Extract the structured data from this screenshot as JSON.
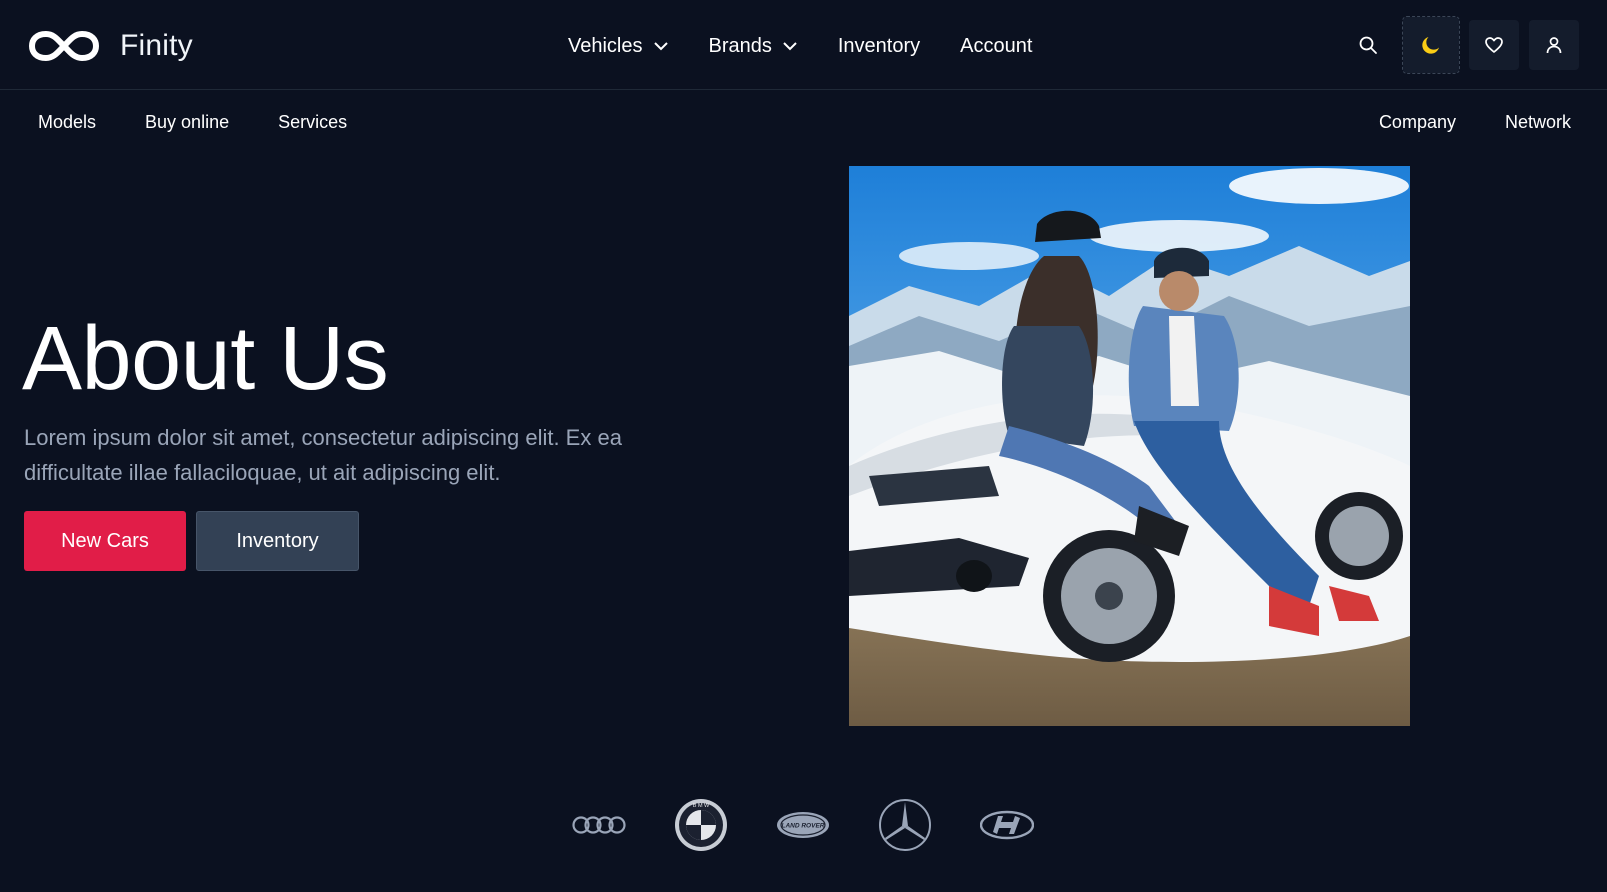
{
  "header": {
    "brand_name": "Finity",
    "logo_icon": "infinity-logo-icon",
    "nav": [
      {
        "label": "Vehicles",
        "has_dropdown": true
      },
      {
        "label": "Brands",
        "has_dropdown": true
      },
      {
        "label": "Inventory",
        "has_dropdown": false
      },
      {
        "label": "Account",
        "has_dropdown": false
      }
    ],
    "tools": [
      "search-icon",
      "moon-icon",
      "heart-icon",
      "user-icon"
    ],
    "moon_color": "#facc15"
  },
  "subnav": {
    "left": [
      "Models",
      "Buy online",
      "Services"
    ],
    "right": [
      "Company",
      "Network"
    ]
  },
  "hero": {
    "title": "About Us",
    "text": "Lorem ipsum dolor sit amet, consectetur adipiscing elit. Ex ea difficultate illae fallaciloquae, ut ait adipiscing elit.",
    "primary_button": "New Cars",
    "secondary_button": "Inventory",
    "accent_color": "#e11d48"
  },
  "brand_logos": [
    "audi-logo-icon",
    "bmw-logo-icon",
    "land-rover-logo-icon",
    "mercedes-logo-icon",
    "hyundai-logo-icon"
  ],
  "brand_logo_text": {
    "bmw": "B M W",
    "land_rover": "LAND ROVER"
  },
  "colors": {
    "background": "#0b1120",
    "muted_text": "#9aa5b8",
    "secondary_button": "#334155"
  }
}
